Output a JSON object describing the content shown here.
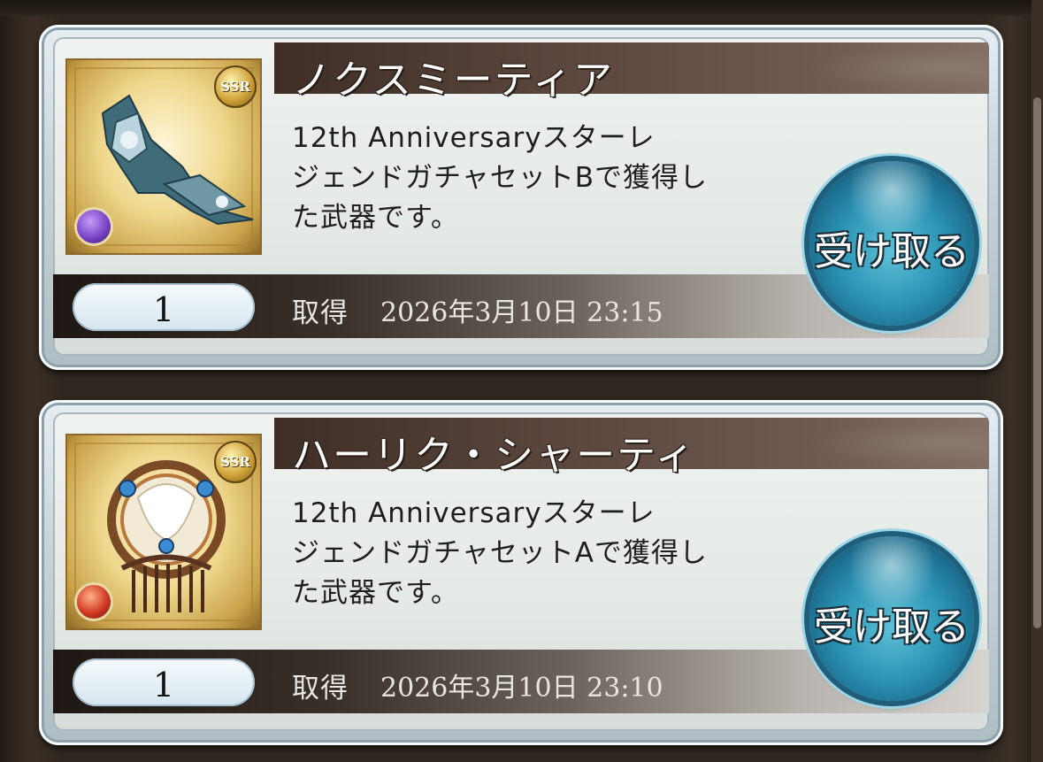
{
  "items": [
    {
      "name": "ノクスミーティア",
      "rarity": "SSR",
      "element": "dark",
      "element_color": "#7a45c8",
      "description": "12th Anniversaryスターレジェンドガチャセットで獲得した武器です。",
      "desc_lines": [
        "12th Anniversaryスターレ",
        "ジェンドガチャセットBで獲得し",
        "た武器です。"
      ],
      "quantity": "1",
      "acquired_label": "取得",
      "acquired_date": "2026年3月10日 23:15",
      "receive_label": "受け取る"
    },
    {
      "name": "ハーリク・シャーティ",
      "rarity": "SSR",
      "element": "fire",
      "element_color": "#d23a24",
      "description": "12th Anniversaryスターレジェンドガチャセットで獲得した武器です。",
      "desc_lines": [
        "12th Anniversaryスターレ",
        "ジェンドガチャセットAで獲得し",
        "た武器です。"
      ],
      "quantity": "1",
      "acquired_label": "取得",
      "acquired_date": "2026年3月10日 23:10",
      "receive_label": "受け取る"
    }
  ],
  "colors": {
    "title_bar": "#4a382f",
    "receive_button": "#2b92b4",
    "background": "#2b241d"
  }
}
